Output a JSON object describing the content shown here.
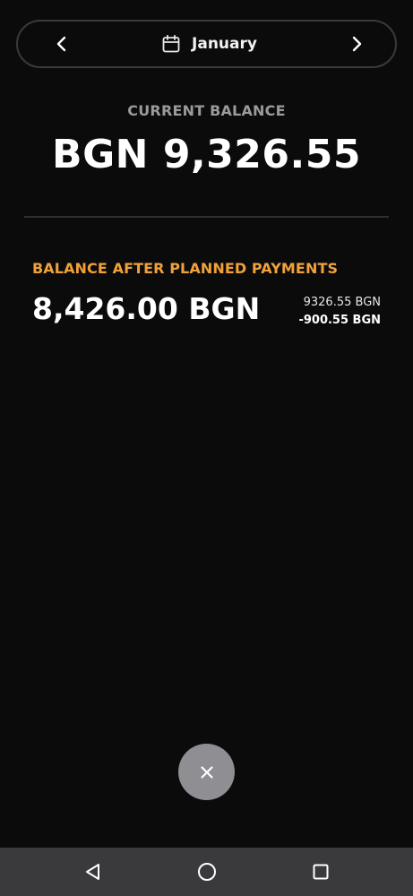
{
  "month_selector": {
    "month": "January",
    "icons": {
      "previous": "chevron-left-icon",
      "next": "chevron-right-icon",
      "calendar": "calendar-icon"
    }
  },
  "current_balance": {
    "label": "CURRENT BALANCE",
    "value": "BGN 9,326.55"
  },
  "planned": {
    "label": "BALANCE AFTER PLANNED PAYMENTS",
    "value": "8,426.00 BGN",
    "breakdown": {
      "current": "9326.55 BGN",
      "planned_payments": "-900.55 BGN"
    }
  },
  "fab": {
    "icon": "close-icon"
  },
  "system_nav": {
    "back": "back-triangle-icon",
    "home": "home-circle-icon",
    "recents": "recents-square-icon"
  },
  "colors": {
    "background": "#0b0b0c",
    "accent": "#f0a13a",
    "muted_label": "#9a9a9e",
    "fab": "#8e8e93",
    "navbar": "#3a3a3c"
  }
}
